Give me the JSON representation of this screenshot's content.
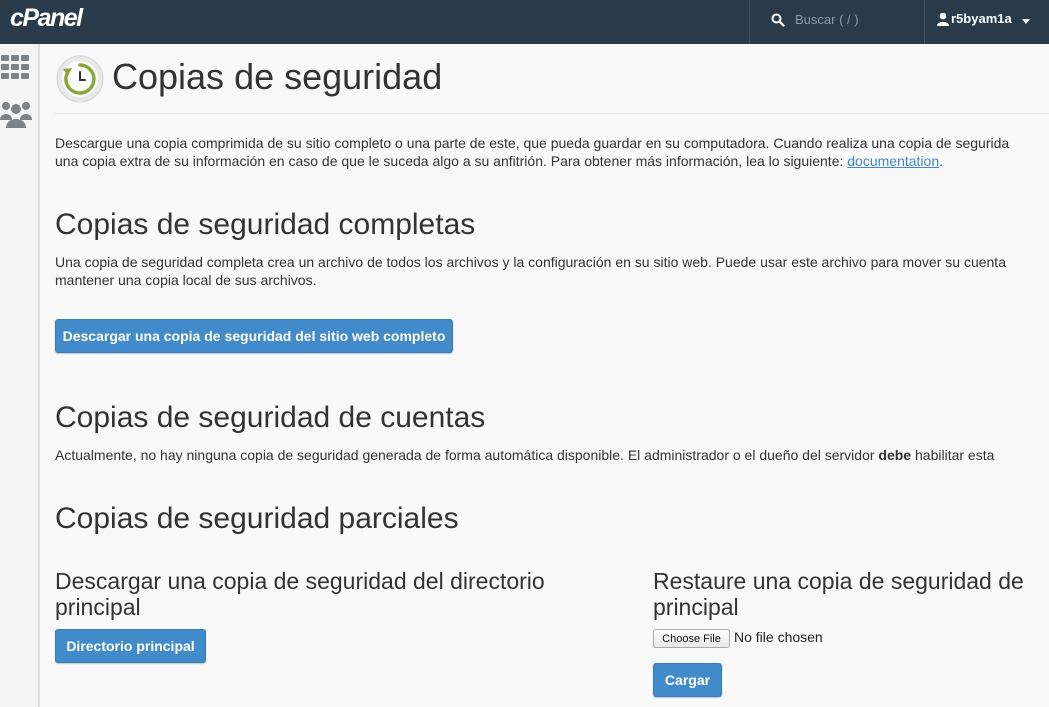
{
  "topbar": {
    "logo": "cPanel",
    "search_placeholder": "Buscar ( / )",
    "username": "r5byam1a"
  },
  "sidebar": {
    "icons": [
      "grid-icon",
      "users-icon"
    ]
  },
  "page": {
    "title": "Copias de seguridad",
    "intro_line1": "Descargue una copia comprimida de su sitio completo o una parte de este, que pueda guardar en su computadora. Cuando realiza una copia de segurida",
    "intro_line2": "una copia extra de su información en caso de que le suceda algo a su anfitrión. Para obtener más información, lea lo siguiente: ",
    "intro_link": "documentation",
    "intro_end": "."
  },
  "full_backup": {
    "heading": "Copias de seguridad completas",
    "desc_line1": "Una copia de seguridad completa crea un archivo de todos los archivos y la configuración en su sitio web. Puede usar este archivo para mover su cuenta",
    "desc_line2": "mantener una copia local de sus archivos.",
    "button": "Descargar una copia de seguridad del sitio web completo"
  },
  "account_backup": {
    "heading": "Copias de seguridad de cuentas",
    "desc_before": "Actualmente, no hay ninguna copia de seguridad generada de forma automática disponible. El administrador o el dueño del servidor ",
    "desc_bold": "debe",
    "desc_after": " habilitar esta"
  },
  "partial_backup": {
    "heading": "Copias de seguridad parciales",
    "download_heading": "Descargar una copia de seguridad del directorio principal",
    "download_button": "Directorio principal",
    "restore_heading": "Restaure una copia de seguridad de principal",
    "restore_heading_line1": "Restaure una copia de seguridad de",
    "restore_heading_line2": "principal",
    "choose_file": "Choose File",
    "file_status": "No file chosen",
    "upload_button": "Cargar"
  },
  "colors": {
    "topbar": "#293a4a",
    "primary": "#428bca",
    "link": "#428bca",
    "icon_green": "#8aa63a"
  }
}
